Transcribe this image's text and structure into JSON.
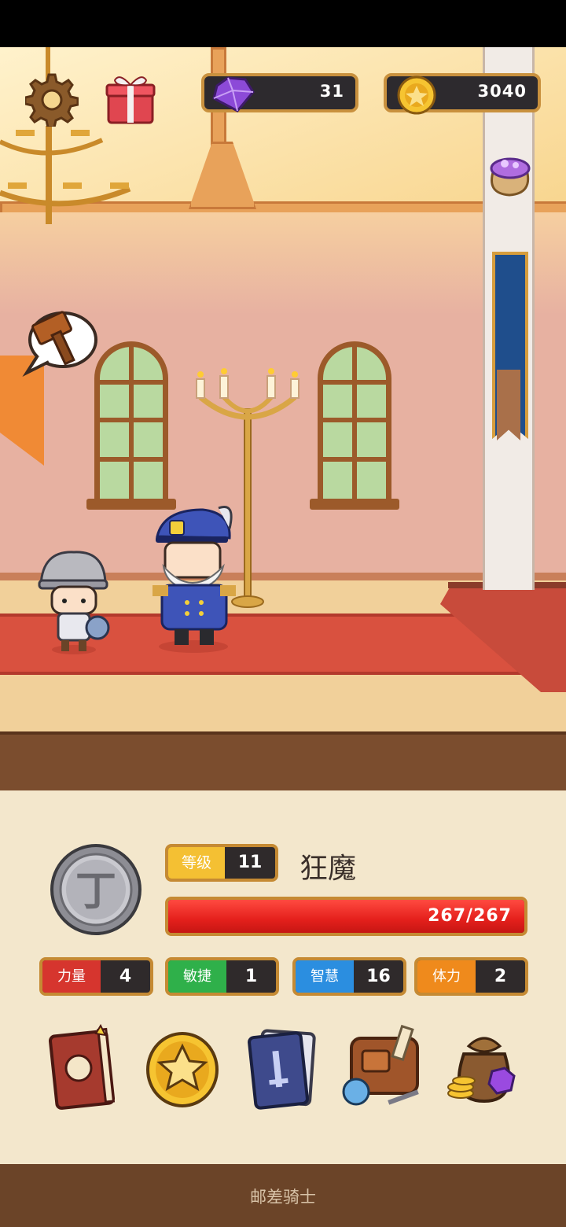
{
  "hud": {
    "gem_count": "31",
    "gold_count": "3040",
    "icons": [
      "gear-icon",
      "gift-box-icon",
      "gem-icon",
      "coin-icon",
      "gem-bag-icon"
    ]
  },
  "scene": {
    "speech_bubble_icon": "hammer-icon",
    "colors": {
      "carpet": "#d9513f",
      "wall": "#e7b1a1",
      "banner_blue": "#1f4e8c",
      "banner_orange": "#f08a35"
    }
  },
  "character": {
    "emblem_letter": "丁",
    "level_label": "等级",
    "level": "11",
    "name": "狂魔",
    "hp_text": "267/267",
    "hp_fraction": 1.0
  },
  "stats": [
    {
      "label": "力量",
      "value": "4",
      "color": "#d6352e"
    },
    {
      "label": "敏捷",
      "value": "1",
      "color": "#2fb04a"
    },
    {
      "label": "智慧",
      "value": "16",
      "color": "#2b8ee0"
    },
    {
      "label": "体力",
      "value": "2",
      "color": "#ef8a1c"
    }
  ],
  "menu": [
    "journal-book-icon",
    "star-coin-icon",
    "cards-icon",
    "backpack-icon",
    "treasure-bag-icon"
  ],
  "footer": {
    "title": "邮差骑士"
  }
}
